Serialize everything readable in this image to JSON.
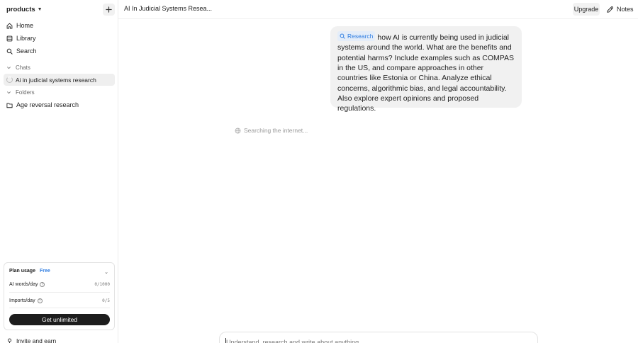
{
  "sidebar": {
    "workspace": "products",
    "nav": [
      {
        "label": "Home",
        "icon": "home-icon"
      },
      {
        "label": "Library",
        "icon": "library-icon"
      },
      {
        "label": "Search",
        "icon": "search-icon"
      }
    ],
    "chats_label": "Chats",
    "chats": [
      {
        "label": "Ai in judicial systems research"
      }
    ],
    "folders_label": "Folders",
    "folders": [
      {
        "label": "Age reversal research"
      }
    ],
    "invite_label": "Invite and earn"
  },
  "plan": {
    "title": "Plan usage",
    "badge": "Free",
    "rows": [
      {
        "label": "AI words/day",
        "value": "0/1000"
      },
      {
        "label": "Imports/day",
        "value": "0/5"
      }
    ],
    "cta": "Get unlimited"
  },
  "topbar": {
    "title": "AI In Judicial Systems Resea...",
    "upgrade": "Upgrade",
    "notes": "Notes"
  },
  "message": {
    "tag": "Research",
    "text": "how AI is currently being used in judicial systems around the world. What are the benefits and potential harms? Include examples such as COMPAS in the US, and compare approaches in other countries like Estonia or China. Analyze ethical concerns, algorithmic bias, and legal accountability. Also explore expert opinions and proposed regulations."
  },
  "status": "Searching the internet...",
  "composer": {
    "placeholder": "Understand, research and write about anything"
  },
  "colors": {
    "accent": "#2f7de1",
    "dark_button": "#1d1d1d",
    "bubble": "#f1f1f1"
  }
}
